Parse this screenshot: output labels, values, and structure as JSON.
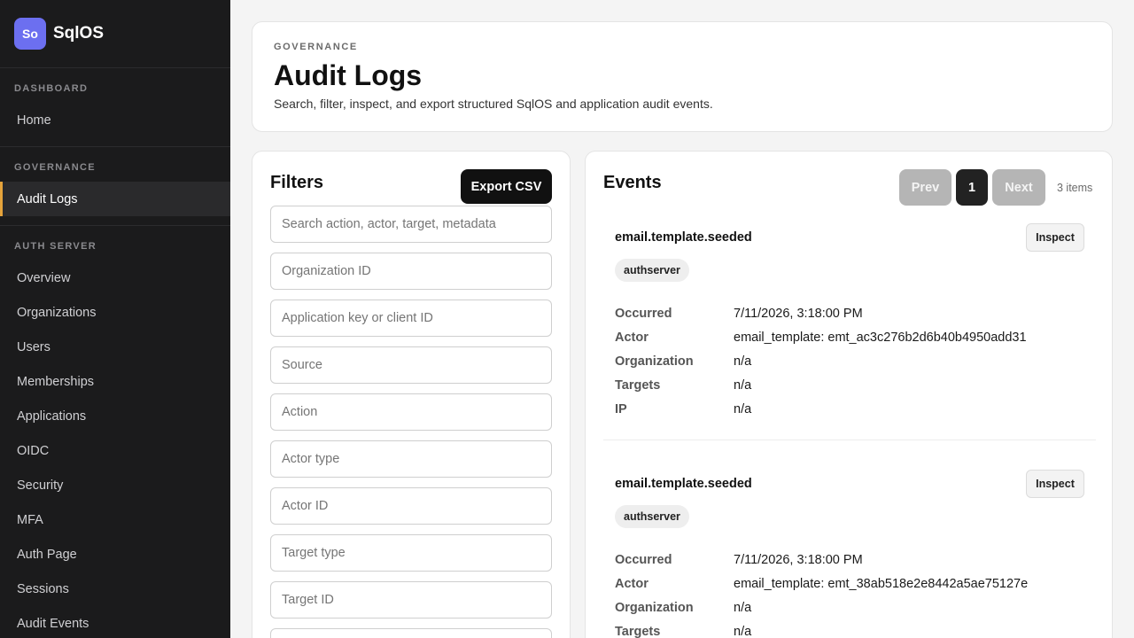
{
  "app": {
    "logo_text": "So",
    "name": "SqlOS",
    "accent_color": "#6c6ff0",
    "active_indicator_color": "#e5a33b"
  },
  "sidebar": {
    "sections": [
      {
        "heading": "DASHBOARD",
        "items": [
          {
            "label": "Home",
            "active": false
          }
        ]
      },
      {
        "heading": "GOVERNANCE",
        "items": [
          {
            "label": "Audit Logs",
            "active": true
          }
        ]
      },
      {
        "heading": "AUTH SERVER",
        "items": [
          {
            "label": "Overview",
            "active": false
          },
          {
            "label": "Organizations",
            "active": false
          },
          {
            "label": "Users",
            "active": false
          },
          {
            "label": "Memberships",
            "active": false
          },
          {
            "label": "Applications",
            "active": false
          },
          {
            "label": "OIDC",
            "active": false
          },
          {
            "label": "Security",
            "active": false
          },
          {
            "label": "MFA",
            "active": false
          },
          {
            "label": "Auth Page",
            "active": false
          },
          {
            "label": "Sessions",
            "active": false
          },
          {
            "label": "Audit Events",
            "active": false
          }
        ]
      }
    ]
  },
  "header": {
    "eyebrow": "GOVERNANCE",
    "title": "Audit Logs",
    "subtitle": "Search, filter, inspect, and export structured SqlOS and application audit events."
  },
  "filters": {
    "title": "Filters",
    "export_label": "Export CSV",
    "inputs": [
      {
        "placeholder": "Search action, actor, target, metadata",
        "value": ""
      },
      {
        "placeholder": "Organization ID",
        "value": ""
      },
      {
        "placeholder": "Application key or client ID",
        "value": ""
      },
      {
        "placeholder": "Source",
        "value": ""
      },
      {
        "placeholder": "Action",
        "value": ""
      },
      {
        "placeholder": "Actor type",
        "value": ""
      },
      {
        "placeholder": "Actor ID",
        "value": ""
      },
      {
        "placeholder": "Target type",
        "value": ""
      },
      {
        "placeholder": "Target ID",
        "value": ""
      },
      {
        "placeholder": "",
        "value": ""
      }
    ]
  },
  "events": {
    "title": "Events",
    "pagination": {
      "prev_label": "Prev",
      "current_page": "1",
      "next_label": "Next"
    },
    "count_label": "3 items",
    "inspect_label": "Inspect",
    "field_labels": {
      "occurred": "Occurred",
      "actor": "Actor",
      "organization": "Organization",
      "targets": "Targets",
      "ip": "IP"
    },
    "items": [
      {
        "action": "email.template.seeded",
        "source": "authserver",
        "occurred": "7/11/2026, 3:18:00 PM",
        "actor": "email_template: emt_ac3c276b2d6b40b4950add31",
        "organization": "n/a",
        "targets": "n/a",
        "ip": "n/a"
      },
      {
        "action": "email.template.seeded",
        "source": "authserver",
        "occurred": "7/11/2026, 3:18:00 PM",
        "actor": "email_template: emt_38ab518e2e8442a5ae75127e",
        "organization": "n/a",
        "targets": "n/a"
      }
    ]
  }
}
